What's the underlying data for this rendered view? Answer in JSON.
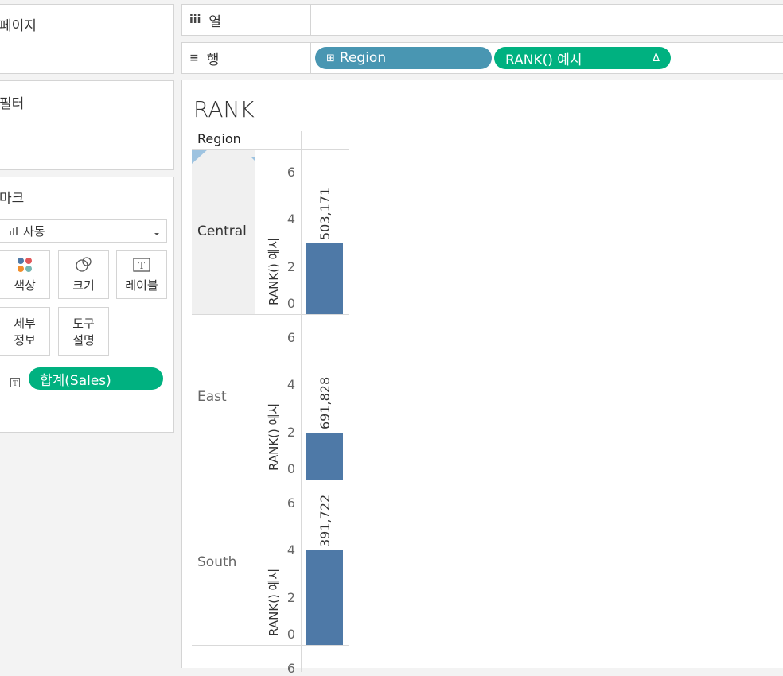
{
  "pages_card": {
    "title": "페이지"
  },
  "filters_card": {
    "title": "필터"
  },
  "marks_card": {
    "title": "마크",
    "mark_type": "자동",
    "buttons": [
      "색상",
      "크기",
      "레이블"
    ],
    "buttons2": [
      [
        "세부",
        "정보"
      ],
      [
        "도구",
        "설명"
      ]
    ],
    "pill": "합계(Sales)"
  },
  "columns_shelf": {
    "label": "열",
    "icon": "iii"
  },
  "rows_shelf": {
    "label": "행",
    "icon": "≡",
    "pills": [
      "Region",
      "RANK() 예시"
    ],
    "pill_plus": "⊞",
    "pill_delta": "Δ"
  },
  "view": {
    "title": "RANK",
    "region_header": "Region",
    "axis_title": "RANK() 예시",
    "ticks": [
      "6",
      "4",
      "2",
      "0"
    ]
  },
  "chart_data": {
    "type": "bar",
    "categories": [
      "Central",
      "East",
      "South"
    ],
    "values": [
      3,
      2,
      4
    ],
    "data_labels": [
      "503,171",
      "691,828",
      "391,722"
    ],
    "ylabel": "RANK() 예시",
    "ylim": [
      0,
      6.5
    ],
    "bar_color": "#4e79a7"
  }
}
